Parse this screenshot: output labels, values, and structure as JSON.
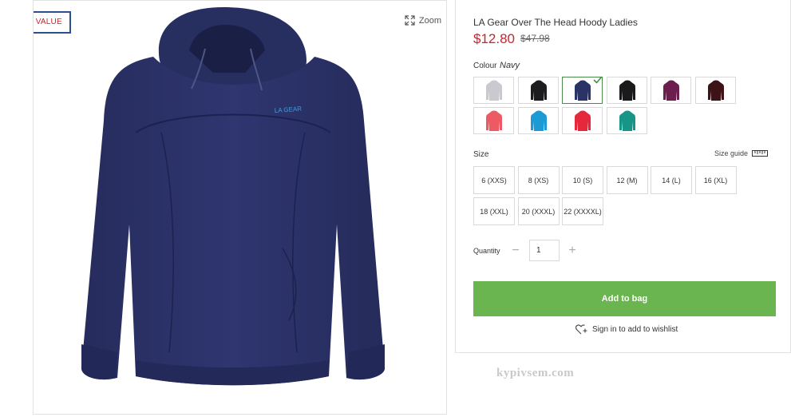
{
  "badge": {
    "label": "MEGA VALUE"
  },
  "gallery": {
    "zoom_label": "Zoom",
    "logo_text": "LA GEAR"
  },
  "product": {
    "title": "LA Gear Over The Head Hoody Ladies",
    "price": "$12.80",
    "old_price": "$47.98"
  },
  "colour": {
    "label": "Colour",
    "selected": "Navy",
    "swatches": [
      {
        "color": "#c9c9cf",
        "selected": false
      },
      {
        "color": "#1d1d1f",
        "selected": false
      },
      {
        "color": "#2b3266",
        "selected": true
      },
      {
        "color": "#1a1a1c",
        "selected": false
      },
      {
        "color": "#6c1e4f",
        "selected": false
      },
      {
        "color": "#3d1317",
        "selected": false
      },
      {
        "color": "#ec5a63",
        "selected": false
      },
      {
        "color": "#1c9ad6",
        "selected": false
      },
      {
        "color": "#e6283c",
        "selected": false
      },
      {
        "color": "#179688",
        "selected": false
      }
    ]
  },
  "size": {
    "label": "Size",
    "guide_label": "Size guide",
    "options": [
      "6 (XXS)",
      "8 (XS)",
      "10 (S)",
      "12 (M)",
      "14 (L)",
      "16 (XL)",
      "18 (XXL)",
      "20 (XXXL)",
      "22 (XXXXL)"
    ]
  },
  "quantity": {
    "label": "Quantity",
    "value": "1",
    "minus": "−",
    "plus": "+"
  },
  "actions": {
    "add_to_bag": "Add to bag",
    "wishlist": "Sign in to add to wishlist"
  },
  "watermark": "kypivsem.com",
  "colors": {
    "price": "#d21f2b",
    "add_to_bag": "#6ab550",
    "badge_border": "#2d4f8f",
    "hoodie": "#2b3266"
  },
  "icons": {
    "zoom": "expand-icon",
    "wishlist": "heart-plus-icon",
    "size_guide": "ruler-icon",
    "selected": "check-icon"
  }
}
